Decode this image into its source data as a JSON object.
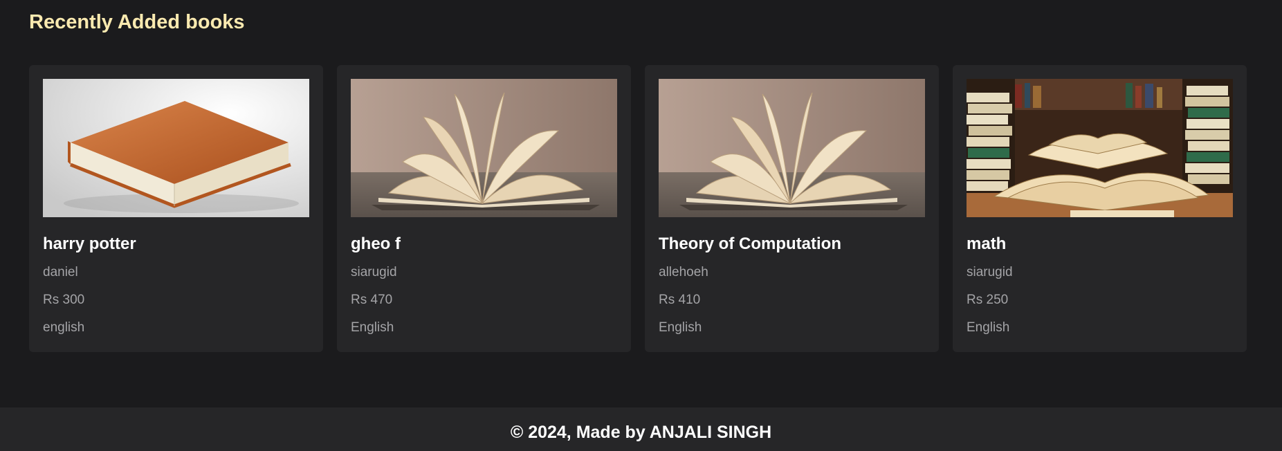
{
  "section": {
    "title": "Recently Added books"
  },
  "books": [
    {
      "title": "harry potter",
      "author": "daniel",
      "price": "Rs 300",
      "language": "english",
      "cover_icon": "closed-book-image"
    },
    {
      "title": "gheo f",
      "author": "siarugid",
      "price": "Rs 470",
      "language": "English",
      "cover_icon": "open-book-image"
    },
    {
      "title": "Theory of Computation",
      "author": "allehoeh",
      "price": "Rs 410",
      "language": "English",
      "cover_icon": "open-book-image"
    },
    {
      "title": "math",
      "author": "siarugid",
      "price": "Rs 250",
      "language": "English",
      "cover_icon": "library-books-image"
    }
  ],
  "footer": {
    "text": "© 2024, Made by ANJALI SINGH"
  },
  "colors": {
    "background": "#1b1b1d",
    "card": "#262628",
    "heading": "#fbeab0",
    "text": "#ffffff",
    "muted": "#a4a4a7"
  }
}
